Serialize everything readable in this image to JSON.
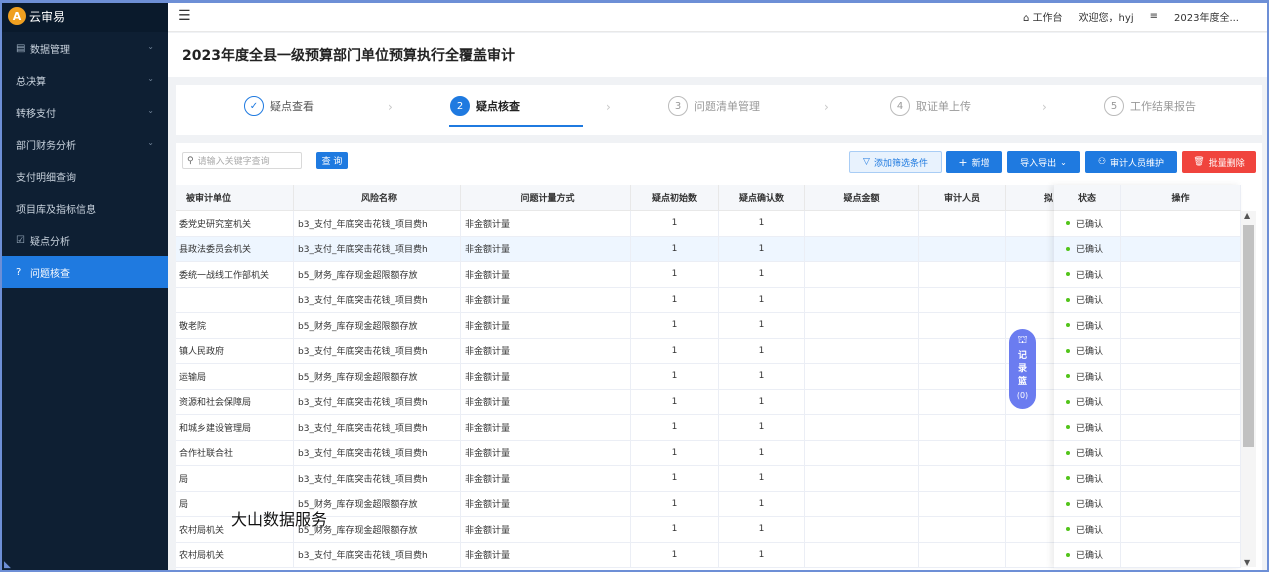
{
  "sidebar": {
    "logo": "云审易",
    "logo_glyph": "A",
    "items": [
      {
        "label": "数据管理",
        "icon": "document-icon",
        "glyph": "▤",
        "chevron": true
      },
      {
        "label": "总决算",
        "chevron": true
      },
      {
        "label": "转移支付",
        "chevron": true
      },
      {
        "label": "部门财务分析",
        "chevron": true
      },
      {
        "label": "支付明细查询"
      },
      {
        "label": "项目库及指标信息"
      },
      {
        "label": "疑点分析",
        "icon": "checkbox-icon",
        "glyph": "☑"
      },
      {
        "label": "问题核查",
        "icon": "question-circle-icon",
        "glyph": "?",
        "active": true
      }
    ]
  },
  "header": {
    "workbench": "工作台",
    "welcome": "欢迎您，hyj",
    "menu_glyph": "≡",
    "project": "2023年度全..."
  },
  "page_title": "2023年度全县一级预算部门单位预算执行全覆盖审计",
  "steps": [
    {
      "num": "✓",
      "label": "疑点查看",
      "state": "done"
    },
    {
      "num": "2",
      "label": "疑点核查",
      "state": "current"
    },
    {
      "num": "3",
      "label": "问题清单管理",
      "state": "todo"
    },
    {
      "num": "4",
      "label": "取证单上传",
      "state": "todo"
    },
    {
      "num": "5",
      "label": "工作结果报告",
      "state": "todo"
    }
  ],
  "toolbar": {
    "search_placeholder": "请输入关键字查询",
    "search_button": "查 询",
    "filter": "添加筛选条件",
    "add": "新增",
    "import_export": "导入导出",
    "auditor": "审计人员维护",
    "batch_delete": "批量删除"
  },
  "table": {
    "headers": {
      "unit": "被审计单位",
      "risk": "风险名称",
      "method": "问题计量方式",
      "initial": "疑点初始数",
      "confirmed": "疑点确认数",
      "amount": "疑点金额",
      "auditor": "审计人员",
      "plan": "拟",
      "status": "状态",
      "operation": "操作"
    },
    "rows": [
      {
        "unit": "委党史研究室机关",
        "risk": "b3_支付_年底突击花钱_项目费h",
        "method": "非金额计量",
        "initial": "1",
        "confirmed": "1",
        "status": "已确认"
      },
      {
        "unit": "县政法委员会机关",
        "risk": "b3_支付_年底突击花钱_项目费h",
        "method": "非金额计量",
        "initial": "1",
        "confirmed": "1",
        "status": "已确认"
      },
      {
        "unit": "委统一战线工作部机关",
        "risk": "b5_财务_库存现金超限额存放",
        "method": "非金额计量",
        "initial": "1",
        "confirmed": "1",
        "status": "已确认"
      },
      {
        "unit": "",
        "risk": "b3_支付_年底突击花钱_项目费h",
        "method": "非金额计量",
        "initial": "1",
        "confirmed": "1",
        "status": "已确认"
      },
      {
        "unit": "敬老院",
        "risk": "b5_财务_库存现金超限额存放",
        "method": "非金额计量",
        "initial": "1",
        "confirmed": "1",
        "status": "已确认"
      },
      {
        "unit": "镇人民政府",
        "risk": "b3_支付_年底突击花钱_项目费h",
        "method": "非金额计量",
        "initial": "1",
        "confirmed": "1",
        "status": "已确认"
      },
      {
        "unit": "运输局",
        "risk": "b5_财务_库存现金超限额存放",
        "method": "非金额计量",
        "initial": "1",
        "confirmed": "1",
        "status": "已确认"
      },
      {
        "unit": "资源和社会保障局",
        "risk": "b3_支付_年底突击花钱_项目费h",
        "method": "非金额计量",
        "initial": "1",
        "confirmed": "1",
        "status": "已确认"
      },
      {
        "unit": "和城乡建设管理局",
        "risk": "b3_支付_年底突击花钱_项目费h",
        "method": "非金额计量",
        "initial": "1",
        "confirmed": "1",
        "status": "已确认"
      },
      {
        "unit": "合作社联合社",
        "risk": "b3_支付_年底突击花钱_项目费h",
        "method": "非金额计量",
        "initial": "1",
        "confirmed": "1",
        "status": "已确认"
      },
      {
        "unit": "局",
        "risk": "b3_支付_年底突击花钱_项目费h",
        "method": "非金额计量",
        "initial": "1",
        "confirmed": "1",
        "status": "已确认"
      },
      {
        "unit": "局",
        "risk": "b5_财务_库存现金超限额存放",
        "method": "非金额计量",
        "initial": "1",
        "confirmed": "1",
        "status": "已确认"
      },
      {
        "unit": "农村局机关",
        "risk": "b5_财务_库存现金超限额存放",
        "method": "非金额计量",
        "initial": "1",
        "confirmed": "1",
        "status": "已确认"
      },
      {
        "unit": "农村局机关",
        "risk": "b3_支付_年底突击花钱_项目费h",
        "method": "非金额计量",
        "initial": "1",
        "confirmed": "1",
        "status": "已确认"
      }
    ]
  },
  "record_basket": {
    "chars": [
      "记",
      "录",
      "篮"
    ],
    "count": "(0)"
  },
  "watermark": "大山数据服务"
}
